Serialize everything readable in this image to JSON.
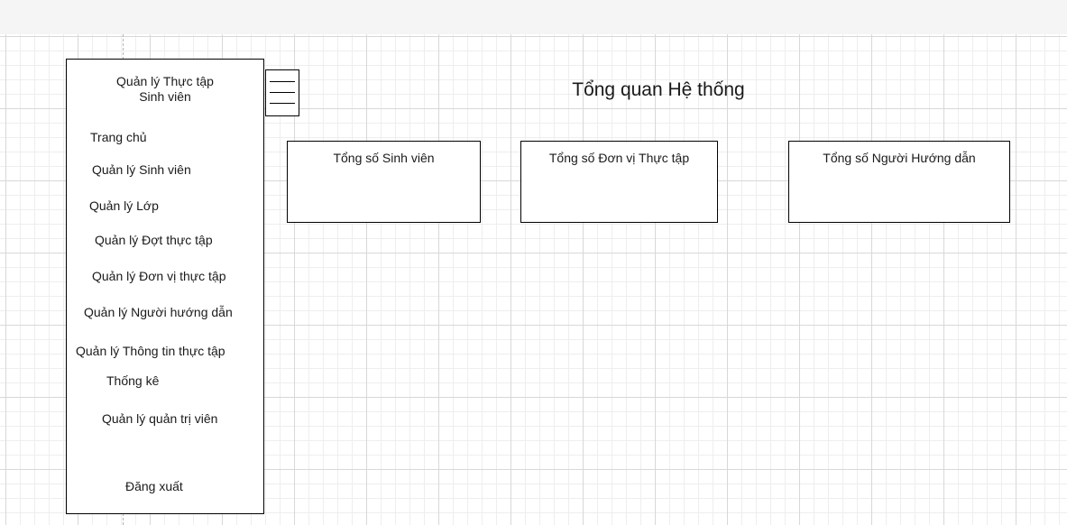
{
  "sidebar": {
    "title_line1": "Quản lý Thực tập",
    "title_line2": "Sinh viên",
    "items": [
      {
        "label": "Trang chủ"
      },
      {
        "label": "Quản lý Sinh viên"
      },
      {
        "label": "Quản lý Lớp"
      },
      {
        "label": "Quản lý Đợt thực tập"
      },
      {
        "label": "Quản lý Đơn vị thực tập"
      },
      {
        "label": "Quản lý Người hướng dẫn"
      },
      {
        "label": "Quản lý Thông tin thực tập"
      },
      {
        "label": "Thống kê"
      },
      {
        "label": "Quản lý quản trị viên"
      },
      {
        "label": "Đăng xuất"
      }
    ]
  },
  "menu_button": {
    "icon": "hamburger-menu-icon"
  },
  "main": {
    "title": "Tổng quan Hệ thống",
    "cards": [
      {
        "label": "Tổng số Sinh viên"
      },
      {
        "label": "Tổng số Đơn vị Thực tập"
      },
      {
        "label": "Tổng số Người Hướng dẫn"
      }
    ]
  }
}
